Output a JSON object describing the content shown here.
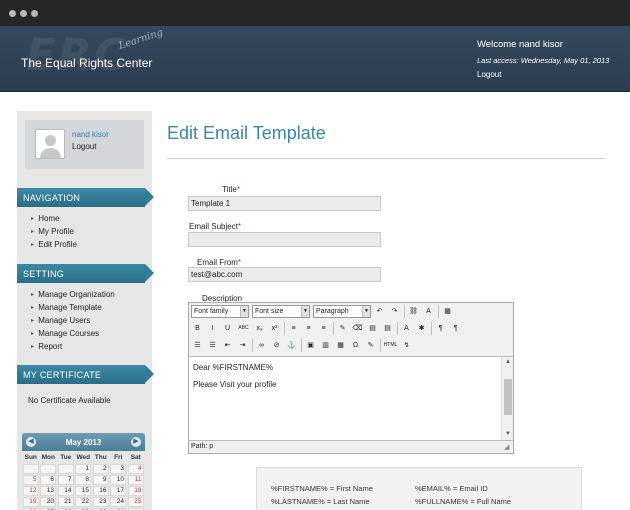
{
  "header": {
    "brand": "The Equal Rights Center",
    "brand_script": "Learning",
    "watermark": "ERC",
    "welcome": "Welcome nand kisor",
    "last_access": "Last access: Wednesday, May 01, 2013",
    "logout": "Logout"
  },
  "sidebar": {
    "profile_name": "nand kisor",
    "profile_logout": "Logout",
    "navigation_title": "NAVIGATION",
    "navigation": [
      "Home",
      "My Profile",
      "Edit Profile"
    ],
    "setting_title": "SETTING",
    "setting": [
      "Manage Organization",
      "Manage Template",
      "Manage Users",
      "Manage Courses",
      "Report"
    ],
    "certificate_title": "MY CERTIFICATE",
    "certificate_text": "No Certificate Available"
  },
  "calendar": {
    "title": "May 2013",
    "prev": "◀",
    "next": "▶",
    "dow": [
      "Sun",
      "Mon",
      "Tue",
      "Wed",
      "Thu",
      "Fri",
      "Sat"
    ],
    "weeks": [
      [
        "",
        "",
        "",
        "1",
        "2",
        "3",
        "4"
      ],
      [
        "5",
        "6",
        "7",
        "8",
        "9",
        "10",
        "11"
      ],
      [
        "12",
        "13",
        "14",
        "15",
        "16",
        "17",
        "18"
      ],
      [
        "19",
        "20",
        "21",
        "22",
        "23",
        "24",
        "25"
      ],
      [
        "26",
        "27",
        "28",
        "29",
        "30",
        "31",
        ""
      ]
    ]
  },
  "main": {
    "title": "Edit Email Template",
    "required_mark": "*",
    "title_label": "Title",
    "title_value": "Template 1",
    "subject_label": "Email Subject",
    "subject_value": "",
    "from_label": "Email From",
    "from_value": "test@abc.com",
    "description_label": "Description"
  },
  "editor": {
    "font_family": "Font family",
    "font_size": "Font size",
    "format": "Paragraph",
    "lines": [
      "Dear %FIRSTNAME%",
      "Please Visit your profile"
    ],
    "path": "Path: p",
    "buttons_row1": [
      "↶",
      "↷",
      "⛓",
      "A",
      "▦"
    ],
    "buttons_row2": [
      "B",
      "I",
      "U",
      "ABC",
      "x₂",
      "x²",
      "≡",
      "≡",
      "≡",
      "✎",
      "⌫",
      "▤",
      "▤",
      "A",
      "✱",
      "¶",
      "¶"
    ],
    "buttons_row3": [
      "☰",
      "☰",
      "⇤",
      "⇥",
      "∞",
      "⊘",
      "⚓",
      "▣",
      "▥",
      "▦",
      "Ω",
      "✎",
      "HTML",
      "↯"
    ]
  },
  "legend": [
    "%FIRSTNAME% = First Name",
    "%EMAIL% = Email ID",
    "%LASTNAME% = Last Name",
    "%FULLNAME% = Full Name"
  ],
  "colors": {
    "header": "#2f4357",
    "accent": "#3a86a8",
    "section": "#337c96",
    "required": "#d42020"
  }
}
